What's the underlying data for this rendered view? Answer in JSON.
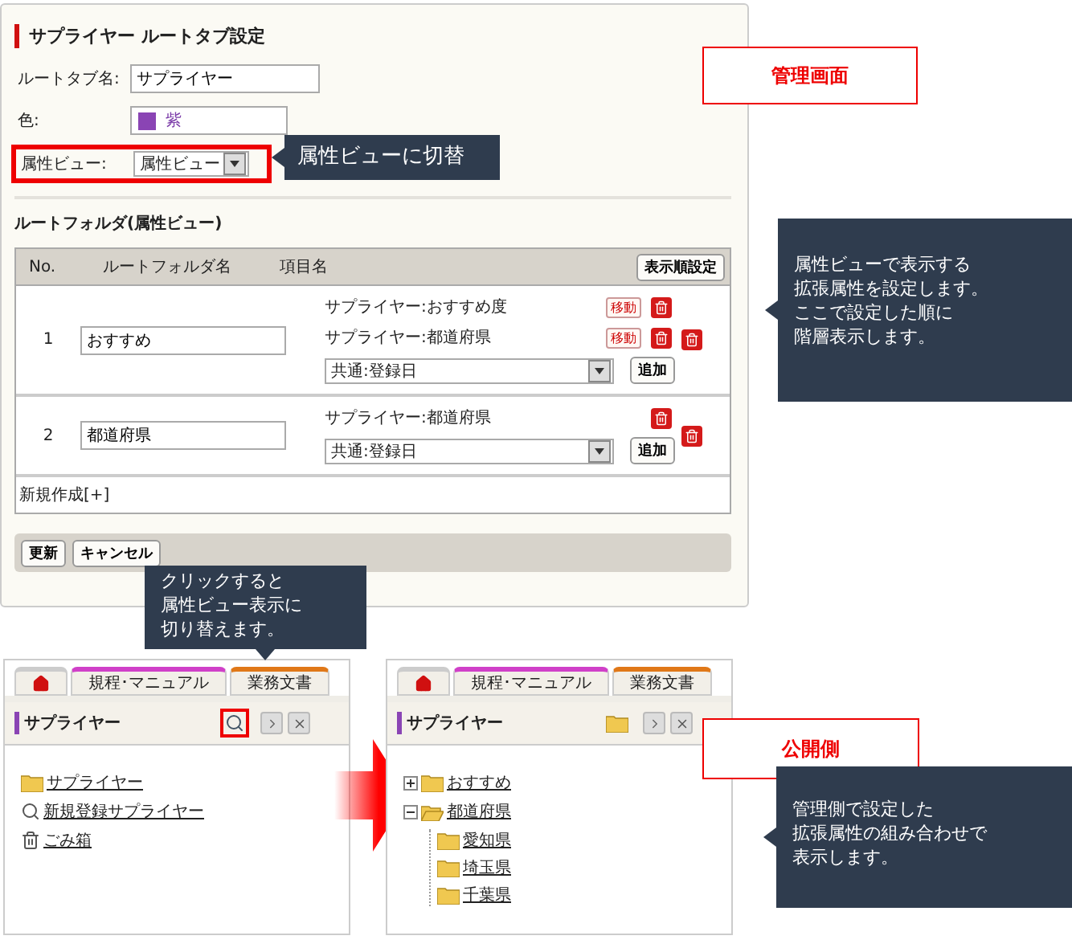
{
  "admin": {
    "title": "サプライヤー ルートタブ設定",
    "name_field": {
      "label": "ルートタブ名:",
      "value": "サプライヤー"
    },
    "color_field": {
      "label": "色:",
      "value": "紫",
      "color": "#8a44b4"
    },
    "view_field": {
      "label": "属性ビュー:",
      "value": "属性ビュー",
      "highlighted": true
    },
    "section_title": "ルートフォルダ(属性ビュー)",
    "table": {
      "columns": [
        "No.",
        "ルートフォルダ名",
        "項目名"
      ],
      "sort_button": "表示順設定",
      "rows": [
        {
          "no": "1",
          "folder": "おすすめ",
          "items": [
            {
              "text": "サプライヤー:おすすめ度",
              "move": "移動"
            },
            {
              "text": "サプライヤー:都道府県",
              "move": "移動"
            }
          ],
          "select": "共通:登録日",
          "add": "追加"
        },
        {
          "no": "2",
          "folder": "都道府県",
          "items": [
            {
              "text": "サプライヤー:都道府県"
            }
          ],
          "select": "共通:登録日",
          "add": "追加"
        }
      ],
      "new_link": "新規作成[+]"
    },
    "buttons": [
      "更新",
      "キャンセル"
    ]
  },
  "labels": [
    {
      "text": "管理画面"
    },
    {
      "text": "公開側"
    }
  ],
  "callouts": [
    {
      "lines": [
        "属性ビューに切替"
      ]
    },
    {
      "lines": [
        "属性ビューで表示する",
        "拡張属性を設定します。",
        "ここで設定した順に",
        "階層表示します。"
      ]
    },
    {
      "lines": [
        "クリックすると",
        "属性ビュー表示に",
        "切り替えます。"
      ]
    },
    {
      "lines": [
        "管理側で設定した",
        "拡張属性の組み合わせで",
        "表示します。"
      ]
    }
  ],
  "panels": [
    {
      "view_button": {
        "kind": "magnifier"
      },
      "highlighted": true,
      "tabs": [
        {
          "kind": "home"
        },
        {
          "kind": "text",
          "label": "規程･マニュアル",
          "color": "#d040c8"
        },
        {
          "kind": "text",
          "label": "業務文書",
          "color": "#e07818"
        }
      ],
      "title": "サプライヤー",
      "tree": [
        {
          "kind": "folder",
          "label": "サプライヤー"
        },
        {
          "kind": "search",
          "label": "新規登録サプライヤー"
        },
        {
          "kind": "trash",
          "label": "ごみ箱"
        }
      ]
    },
    {
      "view_button": {
        "kind": "folder"
      },
      "highlighted": false,
      "tabs": [
        {
          "kind": "home"
        },
        {
          "kind": "text",
          "label": "規程･マニュアル",
          "color": "#d040c8"
        },
        {
          "kind": "text",
          "label": "業務文書",
          "color": "#e07818"
        }
      ],
      "title": "サプライヤー",
      "tree": [
        {
          "kind": "folder",
          "label": "おすすめ",
          "expanded": false
        },
        {
          "kind": "folder",
          "label": "都道府県",
          "expanded": true,
          "children": [
            {
              "kind": "folder",
              "label": "愛知県"
            },
            {
              "kind": "folder",
              "label": "埼玉県"
            },
            {
              "kind": "folder",
              "label": "千葉県"
            }
          ]
        }
      ]
    }
  ]
}
